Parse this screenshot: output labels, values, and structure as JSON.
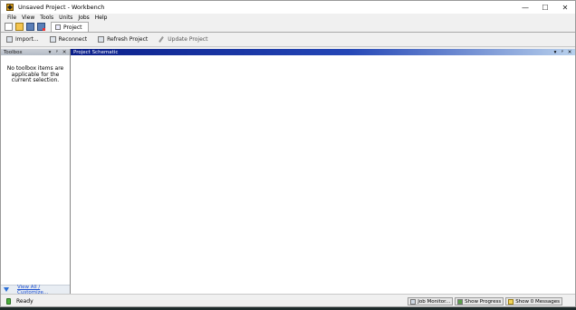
{
  "window": {
    "title": "Unsaved Project - Workbench",
    "controls": {
      "minimize": "—",
      "maximize": "☐",
      "close": "✕"
    }
  },
  "menu": [
    "File",
    "View",
    "Tools",
    "Units",
    "Jobs",
    "Help"
  ],
  "tabs": [
    {
      "label": "Project"
    }
  ],
  "toolbar": {
    "import": "Import...",
    "reconnect": "Reconnect",
    "refresh": "Refresh Project",
    "update": "Update Project"
  },
  "toolbox": {
    "title": "Toolbox",
    "message": "No toolbox items are applicable for the current selection.",
    "footer_link": "View All / Customize..."
  },
  "schematic": {
    "title": "Project Schematic"
  },
  "panel_controls": {
    "dropdown": "▾",
    "pin": "ᵖ",
    "close": "✕"
  },
  "status": {
    "text": "Ready",
    "job_monitor": "Job Monitor...",
    "show_progress": "Show Progress",
    "show_messages": "Show 0 Messages"
  },
  "colors": {
    "schematic_header_start": "#0b1f8a",
    "schematic_header_end": "#b8d0ec",
    "link": "#1b4fd0",
    "status_ready": "#4caf3d"
  }
}
